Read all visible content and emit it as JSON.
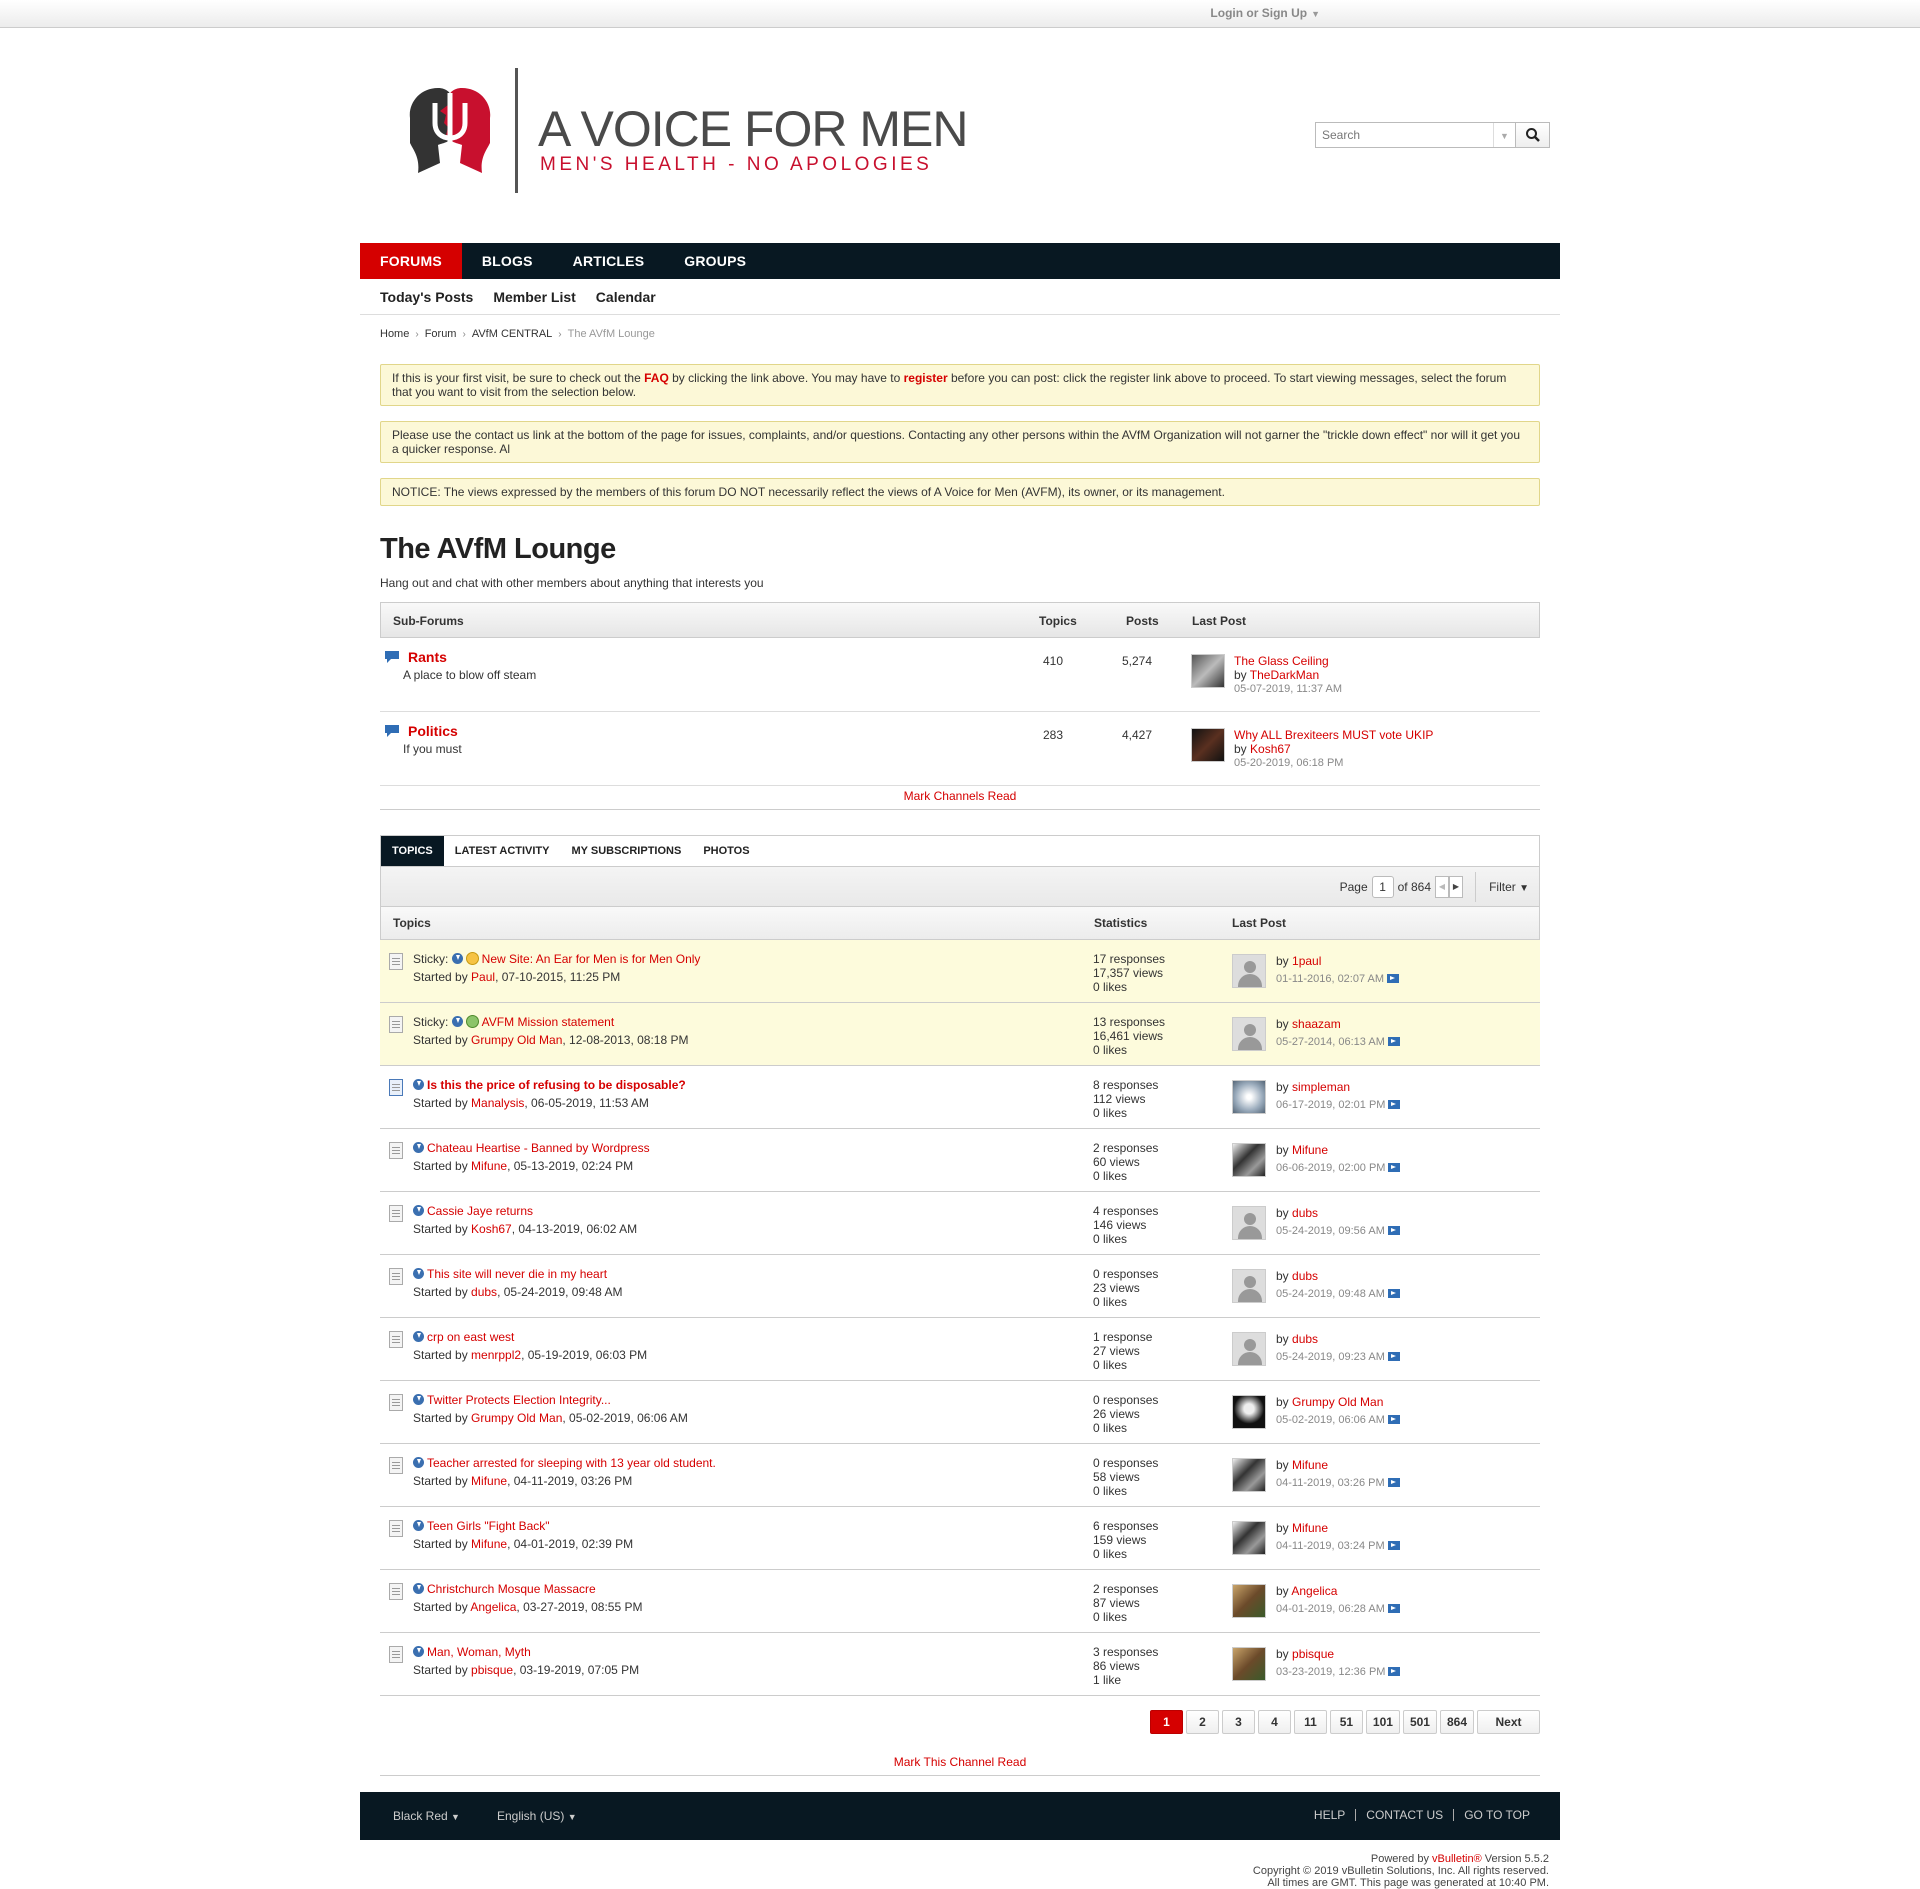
{
  "topbar": {
    "login": "Login or Sign Up"
  },
  "brand": {
    "title": "A VOICE FOR MEN",
    "tagline": "MEN'S HEALTH - NO APOLOGIES",
    "colors": {
      "red": "#d50000",
      "navy": "#081822"
    }
  },
  "search": {
    "placeholder": "Search"
  },
  "nav": {
    "tabs": [
      "FORUMS",
      "BLOGS",
      "ARTICLES",
      "GROUPS"
    ]
  },
  "subnav": [
    "Today's Posts",
    "Member List",
    "Calendar"
  ],
  "breadcrumb": [
    "Home",
    "Forum",
    "AVfM CENTRAL",
    "The AVfM Lounge"
  ],
  "notices": {
    "n1": {
      "a": "If this is your first visit, be sure to check out the ",
      "faq": "FAQ",
      "b": " by clicking the link above. You may have to ",
      "reg": "register",
      "c": " before you can post: click the register link above to proceed. To start viewing messages, select the forum that you want to visit from the selection below."
    },
    "n2": "Please use the contact us link at the bottom of the page for issues, complaints, and/or questions. Contacting any other persons within the AVfM Organization will not garner the \"trickle down effect\" nor will it get you a quicker response. Al",
    "n3": "NOTICE: The views expressed by the members of this forum DO NOT necessarily reflect the views of A Voice for Men (AVFM), its owner, or its management."
  },
  "page": {
    "title": "The AVfM Lounge",
    "description": "Hang out and chat with other members about anything that interests you"
  },
  "subforums": {
    "headers": {
      "name": "Sub-Forums",
      "topics": "Topics",
      "posts": "Posts",
      "last": "Last Post"
    },
    "rows": [
      {
        "name": "Rants",
        "desc": "A place to blow off steam",
        "topics": "410",
        "posts": "5,274",
        "last_title": "The Glass Ceiling",
        "by": "by ",
        "user": "TheDarkMan",
        "date": "05-07-2019, 11:37 AM"
      },
      {
        "name": "Politics",
        "desc": "If you must",
        "topics": "283",
        "posts": "4,427",
        "last_title": "Why ALL Brexiteers MUST vote UKIP",
        "by": "by ",
        "user": "Kosh67",
        "date": "05-20-2019, 06:18 PM"
      }
    ],
    "mark_read": "Mark Channels Read"
  },
  "tabs": [
    "TOPICS",
    "LATEST ACTIVITY",
    "MY SUBSCRIPTIONS",
    "PHOTOS"
  ],
  "pager": {
    "label": "Page",
    "current": "1",
    "of": "of 864",
    "filter": "Filter"
  },
  "topics_header": {
    "topics": "Topics",
    "stats": "Statistics",
    "last": "Last Post"
  },
  "topics": [
    {
      "sticky": "Sticky: ",
      "title": "New Site: An Ear for Men is for Men Only",
      "starter": "Paul",
      "started": ", 07-10-2015, 11:25 PM",
      "responses": "17 responses",
      "views": "17,357 views",
      "likes": "0 likes",
      "lp_user": "1paul",
      "lp_date": "01-11-2016, 02:07 AM"
    },
    {
      "sticky": "Sticky: ",
      "title": "AVFM Mission statement",
      "starter": "Grumpy Old Man",
      "started": ", 12-08-2013, 08:18 PM",
      "responses": "13 responses",
      "views": "16,461 views",
      "likes": "0 likes",
      "lp_user": "shaazam",
      "lp_date": "05-27-2014, 06:13 AM"
    },
    {
      "title": "Is this the price of refusing to be disposable?",
      "starter": "Manalysis",
      "started": ", 06-05-2019, 11:53 AM",
      "responses": "8 responses",
      "views": "112 views",
      "likes": "0 likes",
      "lp_user": "simpleman",
      "lp_date": "06-17-2019, 02:01 PM"
    },
    {
      "title": "Chateau Heartise - Banned by Wordpress",
      "starter": "Mifune",
      "started": ", 05-13-2019, 02:24 PM",
      "responses": "2 responses",
      "views": "60 views",
      "likes": "0 likes",
      "lp_user": "Mifune",
      "lp_date": "06-06-2019, 02:00 PM"
    },
    {
      "title": "Cassie Jaye returns",
      "starter": "Kosh67",
      "started": ", 04-13-2019, 06:02 AM",
      "responses": "4 responses",
      "views": "146 views",
      "likes": "0 likes",
      "lp_user": "dubs",
      "lp_date": "05-24-2019, 09:56 AM"
    },
    {
      "title": "This site will never die in my heart",
      "starter": "dubs",
      "started": ", 05-24-2019, 09:48 AM",
      "responses": "0 responses",
      "views": "23 views",
      "likes": "0 likes",
      "lp_user": "dubs",
      "lp_date": "05-24-2019, 09:48 AM"
    },
    {
      "title": "crp on east west",
      "starter": "menrppl2",
      "started": ", 05-19-2019, 06:03 PM",
      "responses": "1 response",
      "views": "27 views",
      "likes": "0 likes",
      "lp_user": "dubs",
      "lp_date": "05-24-2019, 09:23 AM"
    },
    {
      "title": "Twitter Protects Election Integrity...",
      "starter": "Grumpy Old Man",
      "started": ", 05-02-2019, 06:06 AM",
      "responses": "0 responses",
      "views": "26 views",
      "likes": "0 likes",
      "lp_user": "Grumpy Old Man",
      "lp_date": "05-02-2019, 06:06 AM"
    },
    {
      "title": "Teacher arrested for sleeping with 13 year old student.",
      "starter": "Mifune",
      "started": ", 04-11-2019, 03:26 PM",
      "responses": "0 responses",
      "views": "58 views",
      "likes": "0 likes",
      "lp_user": "Mifune",
      "lp_date": "04-11-2019, 03:26 PM"
    },
    {
      "title": "Teen Girls \"Fight Back\"",
      "starter": "Mifune",
      "started": ", 04-01-2019, 02:39 PM",
      "responses": "6 responses",
      "views": "159 views",
      "likes": "0 likes",
      "lp_user": "Mifune",
      "lp_date": "04-11-2019, 03:24 PM"
    },
    {
      "title": "Christchurch Mosque Massacre",
      "starter": "Angelica",
      "started": ", 03-27-2019, 08:55 PM",
      "responses": "2 responses",
      "views": "87 views",
      "likes": "0 likes",
      "lp_user": "Angelica",
      "lp_date": "04-01-2019, 06:28 AM"
    },
    {
      "title": "Man, Woman, Myth",
      "starter": "pbisque",
      "started": ", 03-19-2019, 07:05 PM",
      "responses": "3 responses",
      "views": "86 views",
      "likes": "1 like",
      "lp_user": "pbisque",
      "lp_date": "03-23-2019, 12:36 PM"
    }
  ],
  "labels": {
    "started_by": "Started by ",
    "by": "by "
  },
  "bottom_pager": [
    "1",
    "2",
    "3",
    "4",
    "11",
    "51",
    "101",
    "501",
    "864",
    "Next"
  ],
  "mark_channel_read": "Mark This Channel Read",
  "footer": {
    "style": "Black Red",
    "language": "English (US)",
    "links": [
      "HELP",
      "CONTACT US",
      "GO TO TOP"
    ]
  },
  "copyright": {
    "l1a": "Powered by ",
    "l1b": "vBulletin®",
    "l1c": " Version 5.5.2",
    "l2": "Copyright © 2019 vBulletin Solutions, Inc. All rights reserved.",
    "l3": "All times are GMT. This page was generated at 10:40 PM."
  }
}
